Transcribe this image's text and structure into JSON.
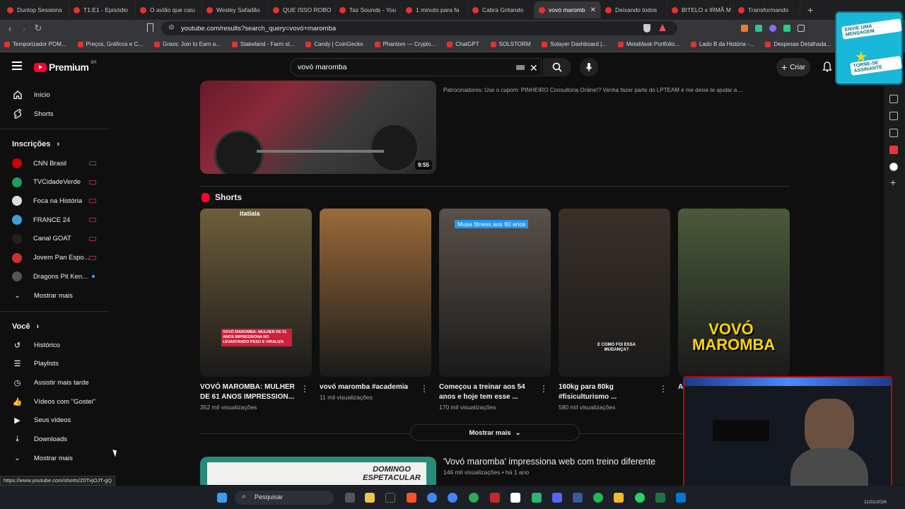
{
  "browser": {
    "tabs": [
      {
        "title": "Dunlop Sessions"
      },
      {
        "title": "T1:E1 - Episódio"
      },
      {
        "title": "O avião que caiu"
      },
      {
        "title": "Wesley Safadão"
      },
      {
        "title": "QUE ISSO ROBO"
      },
      {
        "title": "Taz Sounds - You"
      },
      {
        "title": "1 minuto para fa"
      },
      {
        "title": "Cabra Gritando"
      },
      {
        "title": "vovó maromb",
        "active": true
      },
      {
        "title": "Deixando todos"
      },
      {
        "title": "BITELO x IRMÃ M"
      },
      {
        "title": "Transformando"
      }
    ],
    "url": "youtube.com/results?search_query=vovó+maromba",
    "bookmarks": [
      "Temporizador POM...",
      "Preços, Gráficos e C...",
      "Grass: Join to Earn a...",
      "Stakeland - Farm st...",
      "Candy | CoinGecko",
      "Phantom — Crypto...",
      "ChatGPT",
      "SOLSTORM",
      "Solayer Dashboard |...",
      "MetaMask Portfolio...",
      "Lado B da História -...",
      "Despesas Detalhada..."
    ],
    "status_url": "https://www.youtube.com/shorts/Z0TvjOJT-gQ"
  },
  "header": {
    "logo_text": "Premium",
    "logo_region": "BR",
    "search_value": "vovó maromba",
    "create_label": "Criar"
  },
  "sidebar": {
    "top": [
      {
        "label": "Início",
        "icon": "home-icon"
      },
      {
        "label": "Shorts",
        "icon": "shorts-icon"
      }
    ],
    "subscriptions_title": "Inscrições",
    "subscriptions": [
      {
        "label": "CNN Brasil",
        "color": "#cc0000"
      },
      {
        "label": "TVCidadeVerde",
        "color": "#1e9e5a"
      },
      {
        "label": "Foca na História",
        "color": "#dddddd"
      },
      {
        "label": "FRANCE 24",
        "color": "#3aa0d8"
      },
      {
        "label": "Canal GOAT",
        "color": "#222222"
      },
      {
        "label": "Jovem Pan Espo...",
        "color": "#d32f2f"
      },
      {
        "label": "Dragons Pit Ken...",
        "color": "#555555"
      }
    ],
    "subs_more": "Mostrar mais",
    "you_title": "Você",
    "you_items": [
      {
        "label": "Histórico",
        "icon": "history-icon"
      },
      {
        "label": "Playlists",
        "icon": "playlist-icon"
      },
      {
        "label": "Assistir mais tarde",
        "icon": "clock-icon"
      },
      {
        "label": "Vídeos com \"Gostei\"",
        "icon": "thumbs-up-icon"
      },
      {
        "label": "Seus vídeos",
        "icon": "play-square-icon"
      },
      {
        "label": "Downloads",
        "icon": "download-icon"
      }
    ],
    "you_more": "Mostrar mais"
  },
  "results": {
    "top_video": {
      "duration": "9:55",
      "description": "Patrocinadores: Use o cupom: PINHEIRO Consultoria Online!? Venha fazer parte do LPTEAM e me deixe te ajudar a ..."
    },
    "shorts_title": "Shorts",
    "shorts": [
      {
        "title": "VOVÓ MAROMBA: MULHER DE 61 ANOS IMPRESSION...",
        "views": "352 mil visualizações",
        "overlay": "VOVÓ MAROMBA: MULHER DE 61 ANOS IMPRESSIONA NO LEVANTANDO PESO E VIRALIZA",
        "corner": "itatiaia",
        "bg": "#6e5e3a"
      },
      {
        "title": "vovó maromba #academia",
        "views": "11 mil visualizações",
        "overlay": "",
        "corner": "",
        "bg": "#9a6a3a"
      },
      {
        "title": "Começou a treinar aos 54 anos e hoje tem esse ...",
        "views": "170 mil visualizações",
        "overlay": "Musa fitness aos 60 anos",
        "corner": "",
        "bg": "#5a5048"
      },
      {
        "title": "160kg para 80kg #fisiculturismo ...",
        "views": "580 mil visualizações",
        "overlay": "E COMO FOI ESSA MUDANÇA?",
        "corner": "",
        "bg": "#3a3028"
      },
      {
        "title": "A",
        "views": "",
        "overlay": "VOVÓ MAROMBA",
        "corner": "",
        "bg": "#4a5a3a"
      }
    ],
    "more_label": "Mostrar mais",
    "second_video": {
      "title": "'Vovó maromba' impressiona web com treino diferente",
      "meta": "146 mil visualizações • há 1 ano",
      "thumb_text": "DOMINGO ESPETACULAR"
    }
  },
  "promo": {
    "badge1": "ENVIE UMA MENSAGEM",
    "badge2": "TORNE-SE ASSINANTE"
  },
  "taskbar": {
    "search_placeholder": "Pesquisar",
    "date": "11/01/2026"
  }
}
